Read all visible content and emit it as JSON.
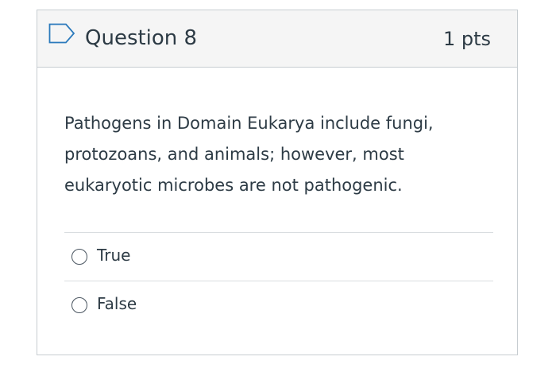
{
  "question": {
    "title": "Question 8",
    "points": "1 pts",
    "flag_icon": "flag-outline-icon",
    "text": "Pathogens in Domain Eukarya include fungi, protozoans, and animals; however, most eukaryotic microbes are not pathogenic.",
    "answers": [
      {
        "label": "True",
        "selected": false
      },
      {
        "label": "False",
        "selected": false
      }
    ]
  },
  "colors": {
    "header_bg": "#f5f5f5",
    "border": "#c7cdd1",
    "text": "#2d3b45",
    "flag_outline": "#2b7abc"
  }
}
